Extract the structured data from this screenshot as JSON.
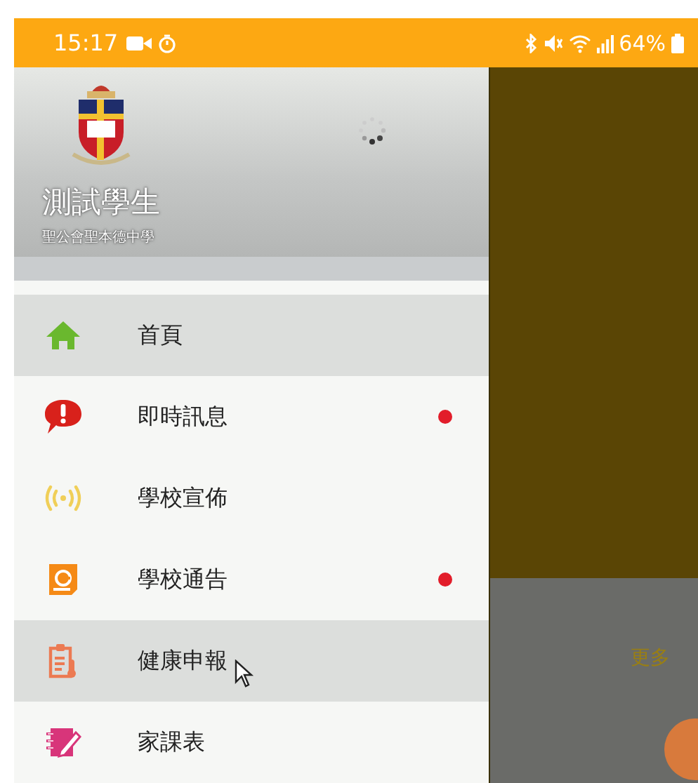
{
  "status_bar": {
    "time": "15:17",
    "battery": "64%"
  },
  "drawer": {
    "user_name": "測試學生",
    "school": "聖公會聖本德中學",
    "items": [
      {
        "label": "首頁",
        "kind": "home",
        "selected": true,
        "unread": false
      },
      {
        "label": "即時訊息",
        "kind": "alert",
        "selected": false,
        "unread": true
      },
      {
        "label": "學校宣佈",
        "kind": "broadcast",
        "selected": false,
        "unread": false
      },
      {
        "label": "學校通告",
        "kind": "notice",
        "selected": false,
        "unread": true
      },
      {
        "label": "健康申報",
        "kind": "health",
        "selected": true,
        "unread": false
      },
      {
        "label": "家課表",
        "kind": "homework",
        "selected": false,
        "unread": false
      }
    ]
  },
  "background": {
    "more_link": "更多"
  }
}
